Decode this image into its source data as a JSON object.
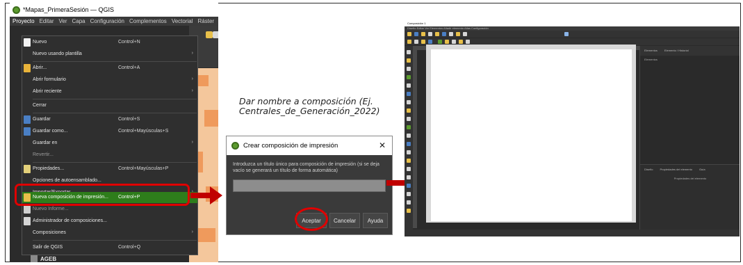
{
  "qgis": {
    "window_title": "*Mapas_PrimeraSesión — QGIS",
    "menubar": [
      "Proyecto",
      "Editar",
      "Ver",
      "Capa",
      "Configuración",
      "Complementos",
      "Vectorial",
      "Ráster"
    ],
    "menu_items": [
      {
        "label": "Nuevo",
        "shortcut": "Control+N",
        "icon": "new-file-icon"
      },
      {
        "label": "Nuevo usando plantilla",
        "submenu": "›"
      },
      {
        "label": "Abrir...",
        "shortcut": "Control+A",
        "icon": "folder-icon"
      },
      {
        "label": "Abrir formulario",
        "submenu": "›"
      },
      {
        "label": "Abrir reciente",
        "submenu": "›"
      },
      {
        "label": "Cerrar"
      },
      {
        "label": "Guardar",
        "shortcut": "Control+S",
        "icon": "save-icon"
      },
      {
        "label": "Guardar como...",
        "shortcut": "Control+Mayúsculas+S",
        "icon": "save-as-icon"
      },
      {
        "label": "Guardar en",
        "submenu": "›"
      },
      {
        "label": "Revertir..."
      },
      {
        "label": "Propiedades...",
        "shortcut": "Control+Mayúsculas+P",
        "icon": "properties-icon"
      },
      {
        "label": "Opciones de autoensamblado..."
      },
      {
        "label": "Importar/Exportar",
        "submenu": "›"
      },
      {
        "label": "Nueva composición de impresión...",
        "shortcut": "Control+P",
        "icon": "new-layout-icon"
      },
      {
        "label": "Nuevo Informe..."
      },
      {
        "label": "Administrador de composiciones...",
        "icon": "layout-manager-icon"
      },
      {
        "label": "Composiciones",
        "submenu": "›"
      },
      {
        "label": "Salir de QGIS",
        "shortcut": "Control+Q"
      }
    ],
    "layer_label": "AGEB"
  },
  "instruction": "Dar nombre a composición (Ej. Centrales_de_Generación_2022)",
  "dialog": {
    "title": "Crear composición de impresión",
    "close": "✕",
    "text": "Introduzca un título único para composición de impresión (si se deja vacío se generará un título de forma automática)",
    "input_value": "",
    "ok_label": "Aceptar",
    "cancel_label": "Cancelar",
    "help_label": "Ayuda"
  },
  "composer": {
    "window_title": "Composición 1",
    "menubar": "Diseño  Editar  Ver  Elementos  Añadir elemento  Atlas  Configuración",
    "right_tabs": [
      "Elementos",
      "Elemento / Historial"
    ],
    "right_sub": "Elementos",
    "bottom_tabs": [
      "Diseño",
      "Propiedades del elemento",
      "Guía"
    ],
    "bottom_title": "Propiedades del elemento"
  },
  "colors": {
    "highlight_ring": "#e00000",
    "selected_item": "#2e7d1b",
    "arrow": "#c00000"
  }
}
